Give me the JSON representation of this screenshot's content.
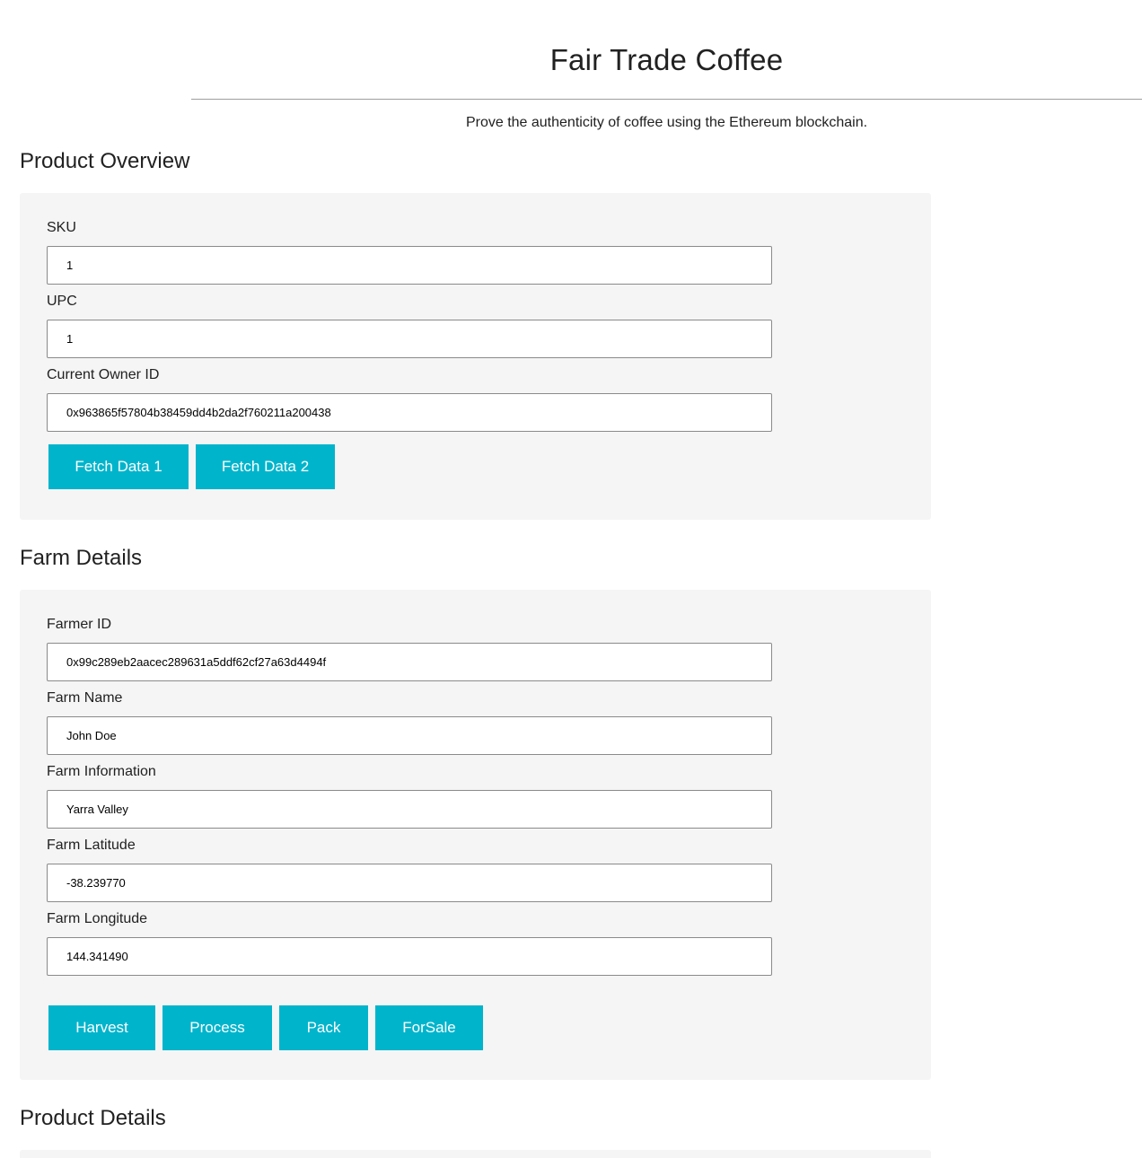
{
  "header": {
    "title": "Fair Trade Coffee",
    "subtitle": "Prove the authenticity of coffee using the Ethereum blockchain."
  },
  "product_overview": {
    "title": "Product Overview",
    "sku_label": "SKU",
    "sku_value": "1",
    "upc_label": "UPC",
    "upc_value": "1",
    "owner_label": "Current Owner ID",
    "owner_value": "0x963865f57804b38459dd4b2da2f760211a200438",
    "fetch1_label": "Fetch Data 1",
    "fetch2_label": "Fetch Data 2"
  },
  "farm_details": {
    "title": "Farm Details",
    "farmer_id_label": "Farmer ID",
    "farmer_id_value": "0x99c289eb2aacec289631a5ddf62cf27a63d4494f",
    "farm_name_label": "Farm Name",
    "farm_name_value": "John Doe",
    "farm_info_label": "Farm Information",
    "farm_info_value": "Yarra Valley",
    "farm_lat_label": "Farm Latitude",
    "farm_lat_value": "-38.239770",
    "farm_long_label": "Farm Longitude",
    "farm_long_value": "144.341490",
    "harvest_label": "Harvest",
    "process_label": "Process",
    "pack_label": "Pack",
    "forsale_label": "ForSale"
  },
  "product_details": {
    "title": "Product Details"
  },
  "theme": {
    "button_color": "#00b4cc",
    "panel_color": "#f5f5f5"
  }
}
